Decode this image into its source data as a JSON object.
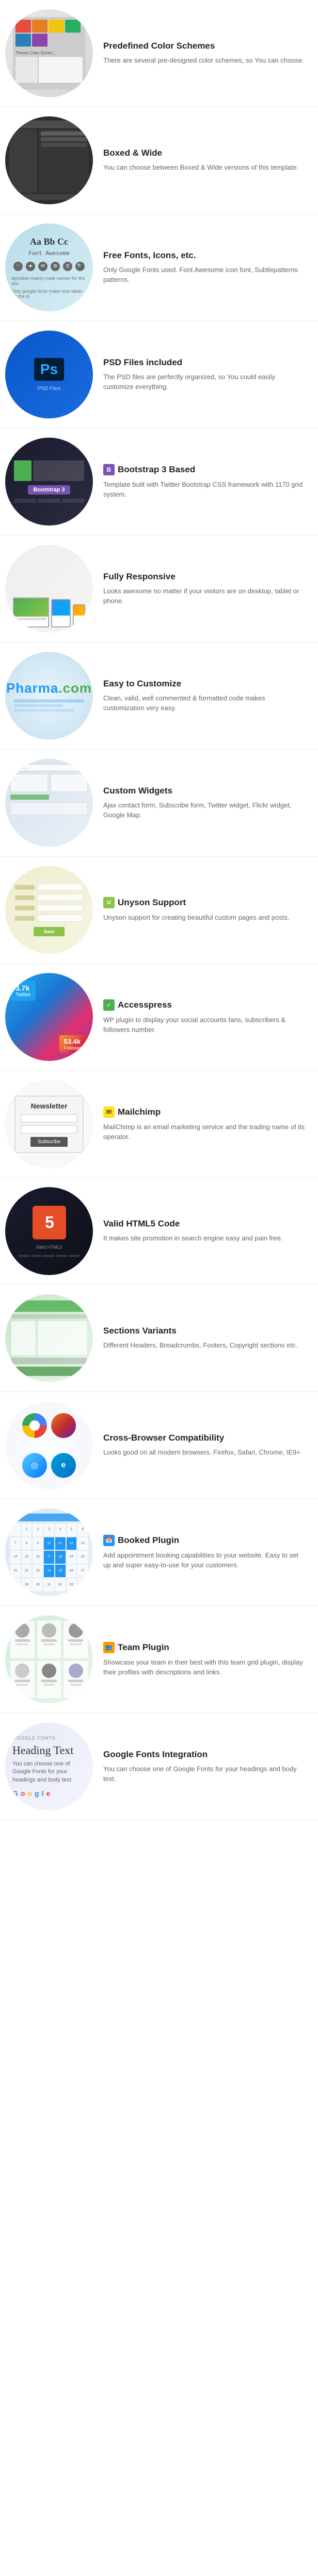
{
  "features": [
    {
      "id": "color-schemes",
      "title": "Predefined Color Schemes",
      "desc": "There are several pre-designed color schemes, so You can choose.",
      "image_type": "color-schemes"
    },
    {
      "id": "boxed-wide",
      "title": "Boxed & Wide",
      "desc": "You can choose between Boxed & Wide versions of this template.",
      "image_type": "boxed-wide"
    },
    {
      "id": "free-fonts",
      "title": "Free Fonts, Icons, etc.",
      "desc": "Only Google Fonts used. Font Awesome icon font, Subtlepatterns patterns.",
      "image_type": "fonts"
    },
    {
      "id": "psd-files",
      "title": "PSD Files included",
      "desc": "The PSD files are perfectly organized, so You could easily customize everything.",
      "image_type": "psd"
    },
    {
      "id": "bootstrap",
      "title": "Bootstrap 3 Based",
      "desc": "Template built with Twitter Bootstrap CSS framework with 1170 grid system.",
      "icon": "B",
      "icon_color": "#7952b3",
      "image_type": "bootstrap"
    },
    {
      "id": "responsive",
      "title": "Fully Responsive",
      "desc": "Looks awesome no matter if your visitors are on desktop, tablet or phone.",
      "image_type": "responsive"
    },
    {
      "id": "customize",
      "title": "Easy to Customize",
      "desc": "Clean, valid, well commented & formatted code makes customization very easy.",
      "image_type": "pharma",
      "pharma_text": "Pharma"
    },
    {
      "id": "widgets",
      "title": "Custom Widgets",
      "desc": "Ajax contact form, Subscribe form, Twitter widget, Flickr widget, Google Map.",
      "image_type": "widgets"
    },
    {
      "id": "unyson",
      "title": "Unyson Support",
      "desc": "Unyson support for creating beautiful custom pages and posts.",
      "icon": "U",
      "icon_color": "#8BC34A",
      "image_type": "unyson"
    },
    {
      "id": "accesspress",
      "title": "Accesspress",
      "desc": "WP plugin to display your social accounts fans, subscribers & followers number.",
      "icon": "✓",
      "icon_color": "#4CAF50",
      "image_type": "social"
    },
    {
      "id": "mailchimp",
      "title": "Mailchimp",
      "desc": "MailChimp is an email marketing service and the trading name of its operator.",
      "image_type": "mailchimp",
      "newsletter_title": "Newsletter"
    },
    {
      "id": "html5",
      "title": "Valid HTML5 Code",
      "desc": "It makes site promotion in search engine easy and pain free.",
      "image_type": "html5"
    },
    {
      "id": "sections",
      "title": "Sections Variants",
      "desc": "Different Headers, Breadcrumbs, Footers, Copyright sections etc.",
      "image_type": "sections"
    },
    {
      "id": "browser",
      "title": "Cross-Browser Compatibility",
      "desc": "Looks good on all modern browsers. Firefox, Safari, Chrome, IE9+",
      "image_type": "browser"
    },
    {
      "id": "booked",
      "title": "Booked Plugin",
      "desc": "Add appointment booking capabilities to your website. Easy to set up and super easy-to-use for your customers.",
      "icon": "📅",
      "icon_color": "#2196F3",
      "image_type": "booked"
    },
    {
      "id": "team",
      "title": "Team Plugin",
      "desc": "Showcase your team in their best with this team grid plugin, display their profiles with descriptions and links.",
      "image_type": "team"
    },
    {
      "id": "google-fonts",
      "title": "Google Fonts Integration",
      "desc": "You can choose one of Google Fonts for your headings and body text.",
      "image_type": "google-fonts"
    }
  ],
  "colors": {
    "swatch1": "#e74c3c",
    "swatch2": "#e67e22",
    "swatch3": "#27ae60",
    "swatch4": "#2980b9",
    "swatch5": "#8e44ad"
  },
  "labels": {
    "bootstrap_badge": "Bootstrap 3",
    "newsletter": "Newsletter",
    "subscribe_btn": "Subscribe",
    "pharma_logo": "Pharma",
    "pharma_logo_suffix": ".com"
  }
}
